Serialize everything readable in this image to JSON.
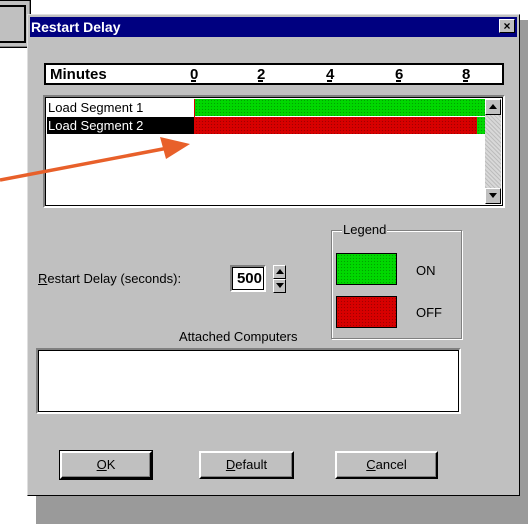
{
  "dialog": {
    "title": "Restart Delay",
    "close_symbol": "×"
  },
  "scale": {
    "label": "Minutes",
    "ticks": [
      "0",
      "2",
      "4",
      "6",
      "8"
    ]
  },
  "chart_rows": [
    {
      "label": "Load Segment 1",
      "state": "ON",
      "selected": false
    },
    {
      "label": "Load Segment 2",
      "state": "OFF",
      "selected": true
    }
  ],
  "restart_delay": {
    "label_accel": "R",
    "label_rest": "estart Delay (seconds):",
    "value": "500"
  },
  "legend": {
    "title": "Legend",
    "items": [
      {
        "label": "ON",
        "color": "#00d800"
      },
      {
        "label": "OFF",
        "color": "#d80000"
      }
    ]
  },
  "attached": {
    "label": "Attached Computers"
  },
  "buttons": {
    "ok_accel": "O",
    "ok_rest": "K",
    "default_accel": "D",
    "default_rest": "efault",
    "cancel_accel": "C",
    "cancel_rest": "ancel"
  },
  "colors": {
    "on": "#00d800",
    "off": "#d80000",
    "titlebar": "#000080",
    "annotation": "#e8602a"
  },
  "icons": {
    "close": "close-icon",
    "scroll_up": "arrow-up-icon",
    "scroll_down": "arrow-down-icon",
    "spin_up": "spin-up-icon",
    "spin_down": "spin-down-icon"
  }
}
